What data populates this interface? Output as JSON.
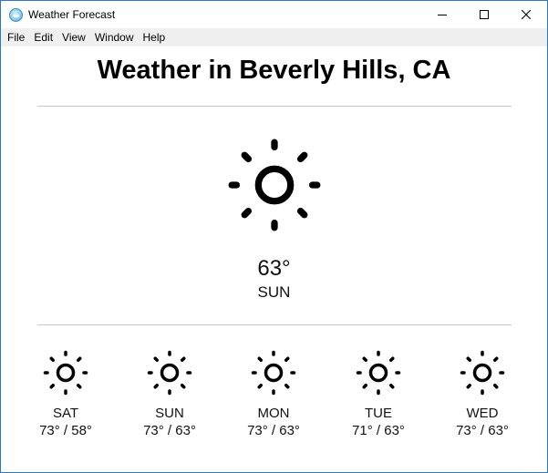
{
  "window": {
    "title": "Weather Forecast",
    "controls": [
      "minimize",
      "maximize",
      "close"
    ]
  },
  "menu": {
    "items": [
      "File",
      "Edit",
      "View",
      "Window",
      "Help"
    ]
  },
  "page": {
    "heading": "Weather in Beverly Hills, CA"
  },
  "current": {
    "icon": "sun-icon",
    "temperature": "63°",
    "day": "SUN"
  },
  "forecast": [
    {
      "day": "SAT",
      "range": "73° / 58°",
      "icon": "sun-icon"
    },
    {
      "day": "SUN",
      "range": "73° / 63°",
      "icon": "sun-icon"
    },
    {
      "day": "MON",
      "range": "73° / 63°",
      "icon": "sun-icon"
    },
    {
      "day": "TUE",
      "range": "71° / 63°",
      "icon": "sun-icon"
    },
    {
      "day": "WED",
      "range": "73° / 63°",
      "icon": "sun-icon"
    }
  ],
  "colors": {
    "window_border": "#2b78c5",
    "menu_background": "#f0f0f0",
    "divider": "#c8c8c8",
    "icon": "#000000"
  }
}
